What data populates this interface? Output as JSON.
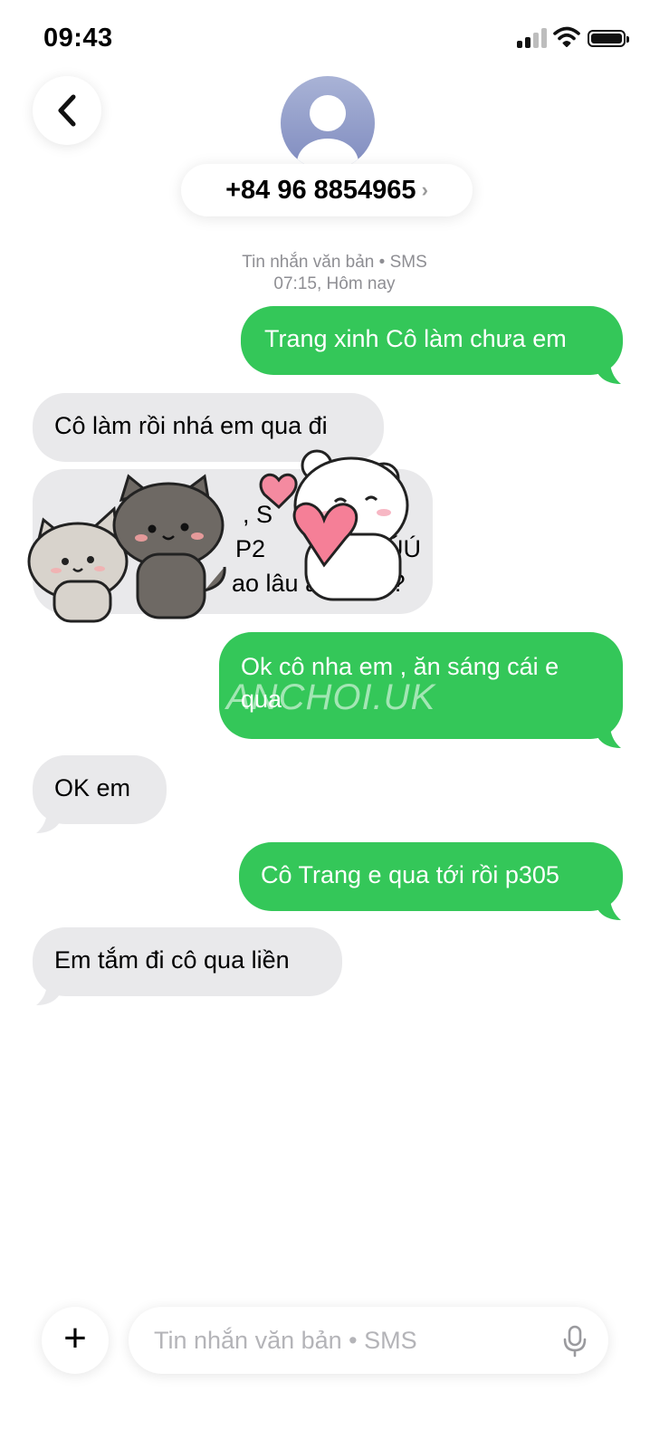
{
  "status_bar": {
    "time": "09:43"
  },
  "header": {
    "contact": "+84 96 8854965",
    "chevron": "›"
  },
  "meta": {
    "service": "Tin nhắn văn bản • SMS",
    "timestamp": "07:15, Hôm nay"
  },
  "messages": [
    {
      "direction": "sent",
      "text": "Trang xinh Cô làm chưa em"
    },
    {
      "direction": "received",
      "text": "Cô làm rồi nhá em qua đi"
    },
    {
      "direction": "received",
      "text": "",
      "visible_fragments": [
        ", S",
        "P2 ",
        "ÚÚ",
        "ao lâu a",
        "a ?"
      ]
    },
    {
      "direction": "sent",
      "text": "Ok cô nha em , ăn sáng cái e qua"
    },
    {
      "direction": "received",
      "text": "OK em"
    },
    {
      "direction": "sent",
      "text": "Cô Trang e qua tới rồi p305"
    },
    {
      "direction": "received",
      "text": "Em tắm đi cô qua liền"
    }
  ],
  "watermark": "ANCHOI.UK",
  "composer": {
    "placeholder": "Tin nhắn văn bản • SMS",
    "plus_label": "+"
  },
  "icons": {
    "back": "chevron-left-icon",
    "mic": "microphone-icon",
    "plus": "plus-icon",
    "avatar": "person-icon"
  },
  "colors": {
    "sent_bubble": "#34c759",
    "received_bubble": "#e9e9eb",
    "meta_text": "#8e8e93"
  }
}
